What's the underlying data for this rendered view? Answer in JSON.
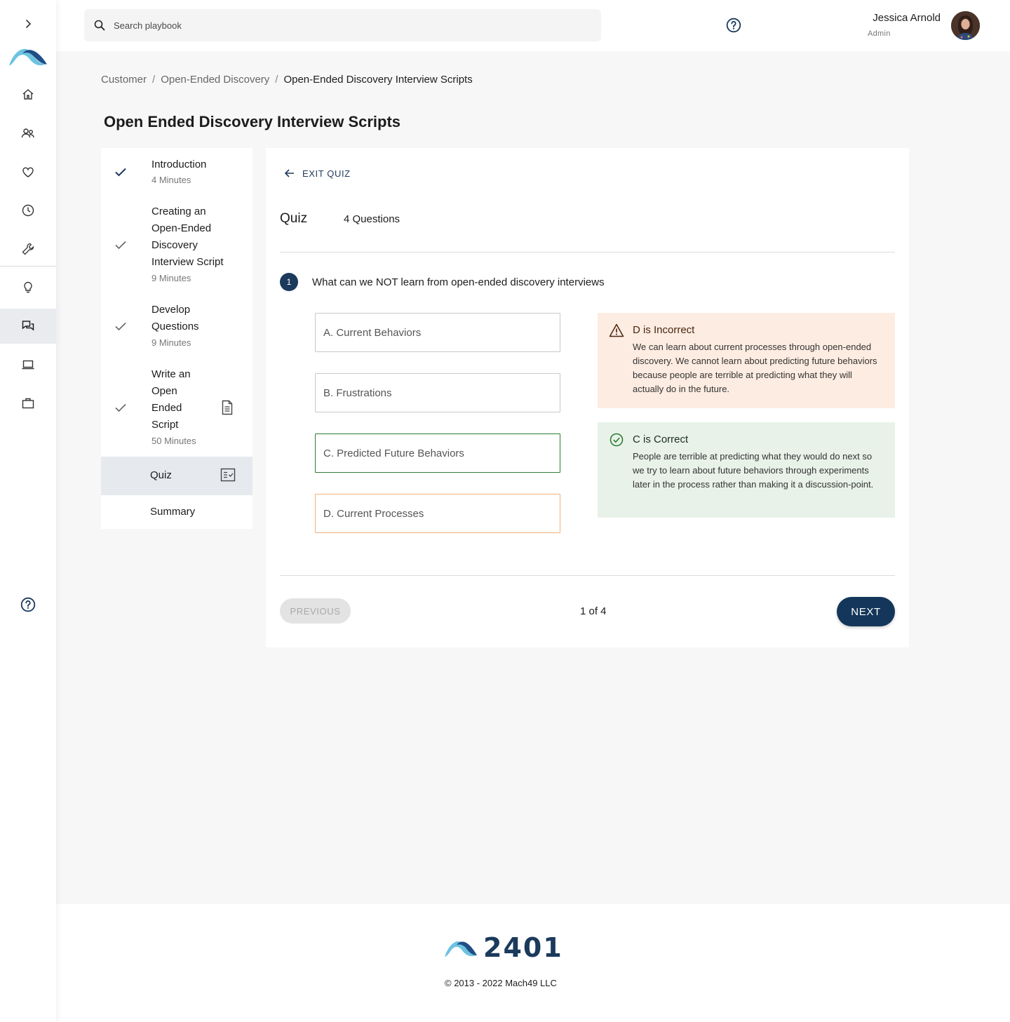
{
  "app": {
    "brand": "2401",
    "copyright": "© 2013 - 2022 Mach49 LLC"
  },
  "header": {
    "search_placeholder": "Search playbook",
    "user": {
      "name": "Jessica Arnold",
      "role": "Admin"
    }
  },
  "sidebar": {
    "items": [
      {
        "icon": "chevron-right-icon"
      },
      {
        "icon": "logo"
      },
      {
        "icon": "home-icon"
      },
      {
        "icon": "users-icon"
      },
      {
        "icon": "heart-icon"
      },
      {
        "icon": "clock-icon"
      },
      {
        "icon": "wrench-icon"
      },
      {
        "icon": "lightbulb-icon"
      },
      {
        "icon": "chat-icon",
        "active": true
      },
      {
        "icon": "laptop-icon"
      },
      {
        "icon": "briefcase-icon"
      },
      {
        "icon": "help-icon"
      }
    ]
  },
  "breadcrumb": {
    "items": [
      "Customer",
      "Open-Ended Discovery",
      "Open-Ended Discovery Interview Scripts"
    ],
    "separator": "/"
  },
  "page": {
    "title": "Open Ended Discovery Interview Scripts"
  },
  "lessons": [
    {
      "lines": [
        "Introduction"
      ],
      "duration": "4 Minutes",
      "status": "complete"
    },
    {
      "lines": [
        "Creating an",
        "Open-Ended",
        "Discovery",
        "Interview Script"
      ],
      "duration": "9 Minutes",
      "status": "complete"
    },
    {
      "lines": [
        "Develop",
        "Questions"
      ],
      "duration": "9 Minutes",
      "status": "complete"
    },
    {
      "lines": [
        "Write an",
        "Open",
        "Ended",
        "Script"
      ],
      "duration": "50 Minutes",
      "status": "complete",
      "icon": "document-icon"
    },
    {
      "lines": [
        "Quiz"
      ],
      "active": true,
      "icon": "quiz-checklist-icon"
    },
    {
      "lines": [
        "Summary"
      ]
    }
  ],
  "quiz": {
    "exit_label": "EXIT QUIZ",
    "label": "Quiz",
    "count": "4 Questions",
    "question": {
      "number": "1",
      "text": "What can we NOT learn from open-ended discovery interviews"
    },
    "options": [
      {
        "label": "A. Current Behaviors",
        "state": "neutral"
      },
      {
        "label": "B. Frustrations",
        "state": "neutral"
      },
      {
        "label": "C. Predicted Future Behaviors",
        "state": "correct"
      },
      {
        "label": "D. Current Processes",
        "state": "incorrect"
      }
    ],
    "feedback": {
      "incorrect": {
        "title": "D is Incorrect",
        "body": "We can learn about current processes through open-ended discovery. We cannot learn about predicting future behaviors because people are terrible at predicting what they will actually do in the future."
      },
      "correct": {
        "title": "C is Correct",
        "body": "People are terrible at predicting what they would do next so we try to learn about future behaviors through experiments later in the process rather than making it a discussion-point."
      }
    },
    "previous_label": "PREVIOUS",
    "pager": "1 of 4",
    "next_label": "NEXT"
  },
  "colors": {
    "navy": "#14365a",
    "correct": "#2e7d32",
    "incorrect": "#f0b27a",
    "incorrect_bg": "#fdece1",
    "correct_bg": "#e8f2e9"
  }
}
